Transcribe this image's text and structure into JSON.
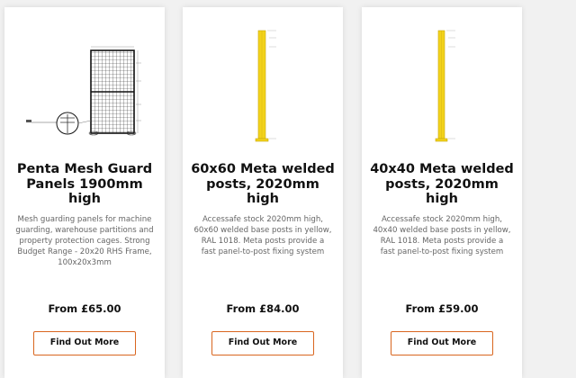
{
  "products": [
    {
      "title": "Penta Mesh Guard Panels 1900mm high",
      "description": "Mesh guarding panels for machine guarding, warehouse partitions and property protection cages. Strong Budget Range - 20x20 RHS Frame, 100x20x3mm",
      "price": "From £65.00",
      "button": "Find Out More",
      "image_icon": "mesh-panel-drawing"
    },
    {
      "title": "60x60 Meta welded posts, 2020mm high",
      "description": "Accessafe stock 2020mm high, 60x60 welded base posts in yellow, RAL 1018. Meta posts provide a fast panel-to-post fixing system",
      "price": "From £84.00",
      "button": "Find Out More",
      "image_icon": "yellow-post-drawing"
    },
    {
      "title": "40x40 Meta welded posts, 2020mm high",
      "description": "Accessafe stock 2020mm high, 40x40 welded base posts in yellow, RAL 1018. Meta posts provide a fast panel-to-post fixing system",
      "price": "From £59.00",
      "button": "Find Out More",
      "image_icon": "yellow-post-drawing"
    }
  ],
  "colors": {
    "accent": "#d9661f",
    "post_yellow": "#f2d21b",
    "background": "#f1f1f1"
  }
}
